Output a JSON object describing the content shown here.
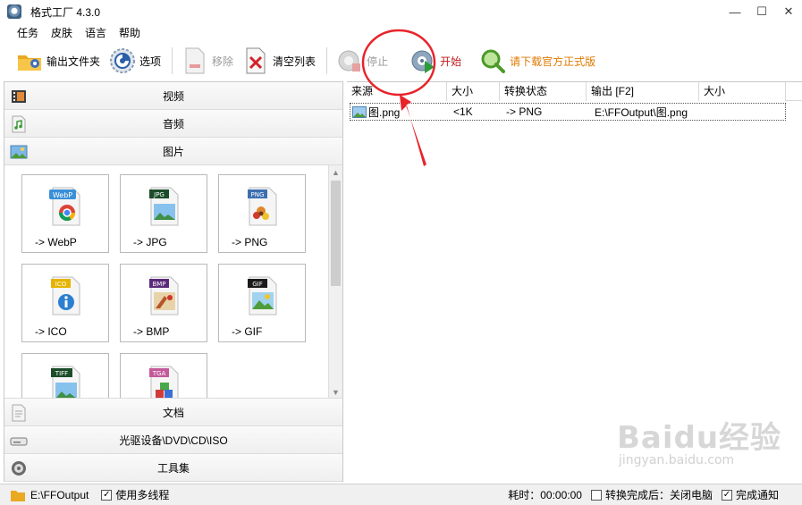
{
  "window": {
    "title": "格式工厂 4.3.0"
  },
  "menu": [
    "任务",
    "皮肤",
    "语言",
    "帮助"
  ],
  "toolbar": {
    "output_folder": "输出文件夹",
    "options": "选项",
    "remove": "移除",
    "clear_list": "清空列表",
    "stop": "停止",
    "start": "开始",
    "download": "请下载官方正式版"
  },
  "categories": {
    "video": "视频",
    "audio": "音频",
    "image": "图片",
    "document": "文档",
    "disc": "光驱设备\\DVD\\CD\\ISO",
    "tools": "工具集"
  },
  "image_formats": [
    {
      "badge": "WebP",
      "label": "-> WebP",
      "color": "#3a8fd8"
    },
    {
      "badge": "JPG",
      "label": "-> JPG",
      "color": "#1b4d2a"
    },
    {
      "badge": "PNG",
      "label": "-> PNG",
      "color": "#3d6fb0"
    },
    {
      "badge": "ICO",
      "label": "-> ICO",
      "color": "#e6b400"
    },
    {
      "badge": "BMP",
      "label": "-> BMP",
      "color": "#5a2a7a"
    },
    {
      "badge": "GIF",
      "label": "-> GIF",
      "color": "#1a1a1a"
    },
    {
      "badge": "TIFF",
      "label": "",
      "color": "#1b4d2a"
    },
    {
      "badge": "TGA",
      "label": "",
      "color": "#c45a9a"
    }
  ],
  "table": {
    "headers": [
      "来源",
      "大小",
      "转换状态",
      "输出 [F2]",
      "大小"
    ],
    "rows": [
      {
        "source": "图.png",
        "size": "<1K",
        "status": "-> PNG",
        "output": "E:\\FFOutput\\图.png",
        "out_size": ""
      }
    ]
  },
  "status": {
    "output_path": "E:\\FFOutput",
    "multithread_label": "使用多线程",
    "multithread_checked": true,
    "elapsed": "耗时：00:00:00",
    "after_convert_label": "转换完成后：关闭电脑",
    "after_convert_checked": false,
    "notify_label": "完成通知",
    "notify_checked": true
  },
  "watermark": {
    "main": "Baidu经验",
    "sub": "jingyan.baidu.com"
  },
  "colors": {
    "annotation_red": "#e8232a",
    "start_green": "#2e9a3a",
    "download_orange": "#e07a00"
  }
}
